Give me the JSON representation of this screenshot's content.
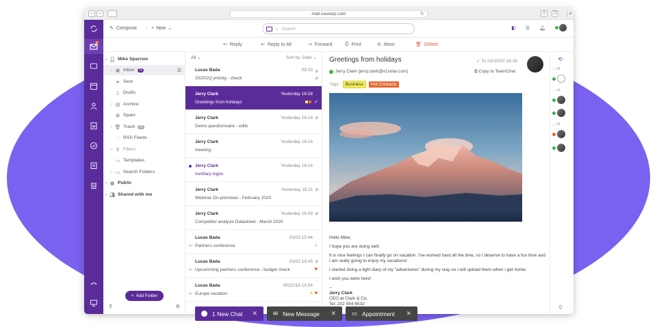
{
  "browser": {
    "url": "mail.icewarp.com"
  },
  "toolbar": {
    "compose": "Compose",
    "new": "New",
    "search_placeholder": "Search"
  },
  "actions": {
    "reply": "Reply",
    "reply_all": "Reply to All",
    "forward": "Forward",
    "print": "Print",
    "more": "More",
    "delete": "Delete"
  },
  "rail": {
    "mail_badge": "2"
  },
  "folders": {
    "account": "Mike Sparrow",
    "items": [
      {
        "label": "Inbox",
        "count": "71"
      },
      {
        "label": "Sent"
      },
      {
        "label": "Drafts"
      },
      {
        "label": "Archive"
      },
      {
        "label": "Spam"
      },
      {
        "label": "Trash",
        "count": "33"
      },
      {
        "label": "RSS Feeds"
      },
      {
        "label": "Filters"
      },
      {
        "label": "Templates"
      },
      {
        "label": "Search Folders"
      }
    ],
    "public": "Public",
    "shared": "Shared with me",
    "add_folder": "Add Folder"
  },
  "list": {
    "filter": "All",
    "sort_label": "Sort by:",
    "sort_value": "Date",
    "items": [
      {
        "from": "Lucas Bada",
        "date": "09:33",
        "subject": "2020/2Q pricing - check"
      },
      {
        "from": "Jerry Clark",
        "date": "Yesterday 16:28",
        "subject": "Greetings from holidays"
      },
      {
        "from": "Jerry Clark",
        "date": "Yesterday 16:18",
        "subject": "Demo questionnaire - edits"
      },
      {
        "from": "Jerry Clark",
        "date": "Yesterday 16:16",
        "subject": "meeting"
      },
      {
        "from": "Jerry Clark",
        "date": "Yesterday 16:14",
        "subject": "IceWarp logos"
      },
      {
        "from": "Jerry Clark",
        "date": "Yesterday 16:11",
        "subject": "Webinar On-premises - February 2020"
      },
      {
        "from": "Jerry Clark",
        "date": "Yesterday 16:09",
        "subject": "Competitor analysis Datasheet - March 2020"
      },
      {
        "from": "Lucas Bada",
        "date": "03/03 15:44",
        "subject": "Partners conference"
      },
      {
        "from": "Lucas Bada",
        "date": "03/02 14:45",
        "subject": "Upcomming partners conference - budget check"
      },
      {
        "from": "Lucas Bada",
        "date": "05/22/19 15:54",
        "subject": "Europe vacation"
      }
    ]
  },
  "reader": {
    "subject": "Greetings from holidays",
    "date": "Tu 03/10/20 16:28",
    "sender": "Jerry Clark (jerry.clark@x1solar.com)",
    "copy": "Copy to TeamChat",
    "tags_label": "Tags:",
    "tag1": "Business",
    "tag2": "Hot Contacts",
    "body": [
      "Hello Mike,",
      "I hope you are doing well.",
      "It is nice feelings I can finally go on vacation. I've worked hard all the time, so I deserve to have a fun time and I am really going to enjoy my vacations!",
      "I started doing a light diary of my \"adventures\" during my stay so I will upload them when i get home.",
      "I wish you were here!"
    ],
    "sig_dash": "--",
    "sig_name": "Jerry Clark",
    "sig_title": "CEO at Clark & Co.",
    "sig_tel": "Tel: 202 554 6532"
  },
  "people": {
    "group1": "Ot",
    "group2": "x1",
    "group3": "Ot"
  },
  "taskbar": {
    "chat": "1 New Chat",
    "message": "New Message",
    "appointment": "Appointment"
  }
}
